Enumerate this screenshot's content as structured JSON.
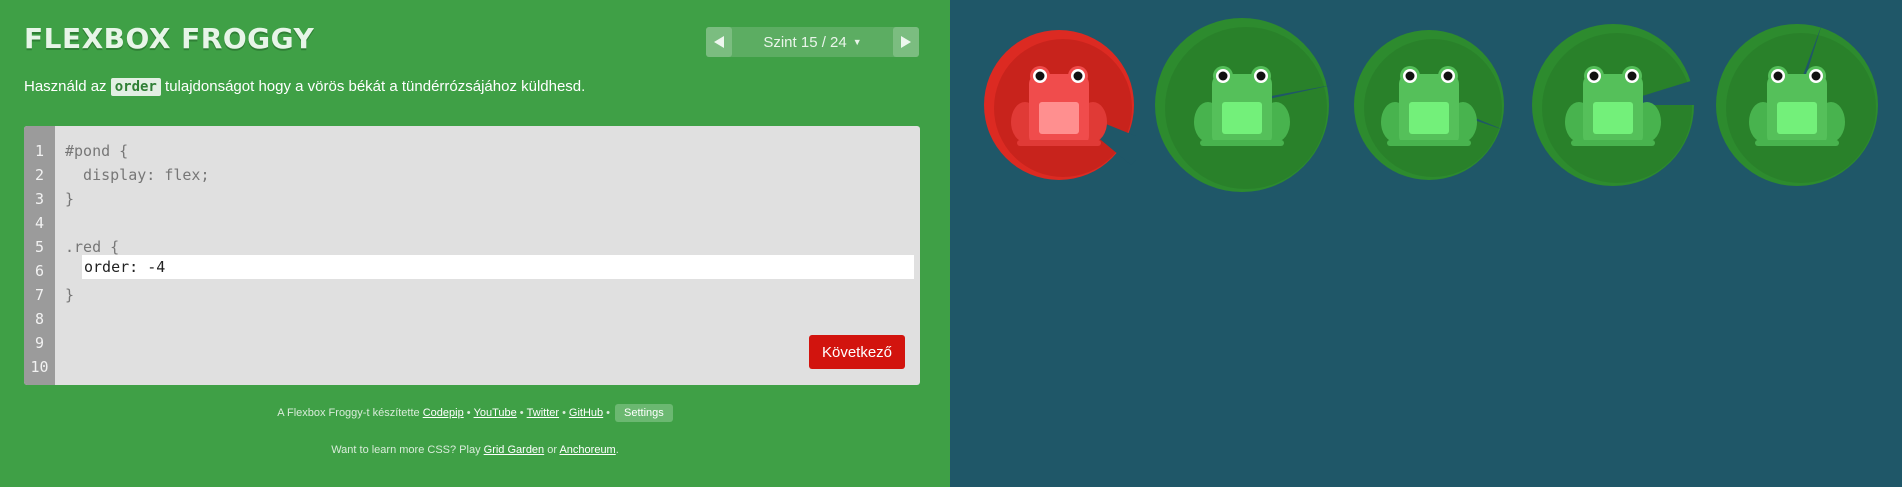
{
  "header": {
    "title": "FLEXBOX FROGGY",
    "level_label": "Szint 15 / 24",
    "prev_icon": "triangle-left-icon",
    "next_icon": "triangle-right-icon",
    "dropdown_icon": "caret-down-icon"
  },
  "instructions": {
    "before": "Használd az ",
    "keyword": "order",
    "after": " tulajdonságot hogy a vörös békát a tündérrózsájához küldhesd."
  },
  "editor": {
    "line_numbers": [
      "1",
      "2",
      "3",
      "4",
      "5",
      "6",
      "7",
      "8",
      "9",
      "10"
    ],
    "lines": [
      "#pond {",
      "  display: flex;",
      "}",
      "",
      ".red {",
      "",
      "}",
      "",
      "",
      ""
    ],
    "input_value": "order: -4",
    "next_button": "Következő"
  },
  "footer": {
    "credit_prefix": "A Flexbox Froggy-t készítette",
    "links": [
      "Codepip",
      "YouTube",
      "Twitter",
      "GitHub"
    ],
    "separator": "•",
    "settings": "Settings",
    "more_prefix": "Want to learn more CSS? Play",
    "more_link1": "Grid Garden",
    "more_or": "or",
    "more_link2": "Anchoreum",
    "more_end": "."
  },
  "pond": {
    "lilypads": [
      "red",
      "green",
      "green",
      "green",
      "green"
    ],
    "frogs": [
      "red",
      "green",
      "green",
      "green",
      "green"
    ]
  },
  "colors": {
    "sidebar_bg": "#3fa046",
    "pond_bg": "#1f5768",
    "red_lilypad": "#dc2a22",
    "green_lilypad": "#2d8b2e",
    "red_frog": "#f04c4c",
    "green_frog": "#55c05a",
    "next_button": "#d2140e"
  }
}
